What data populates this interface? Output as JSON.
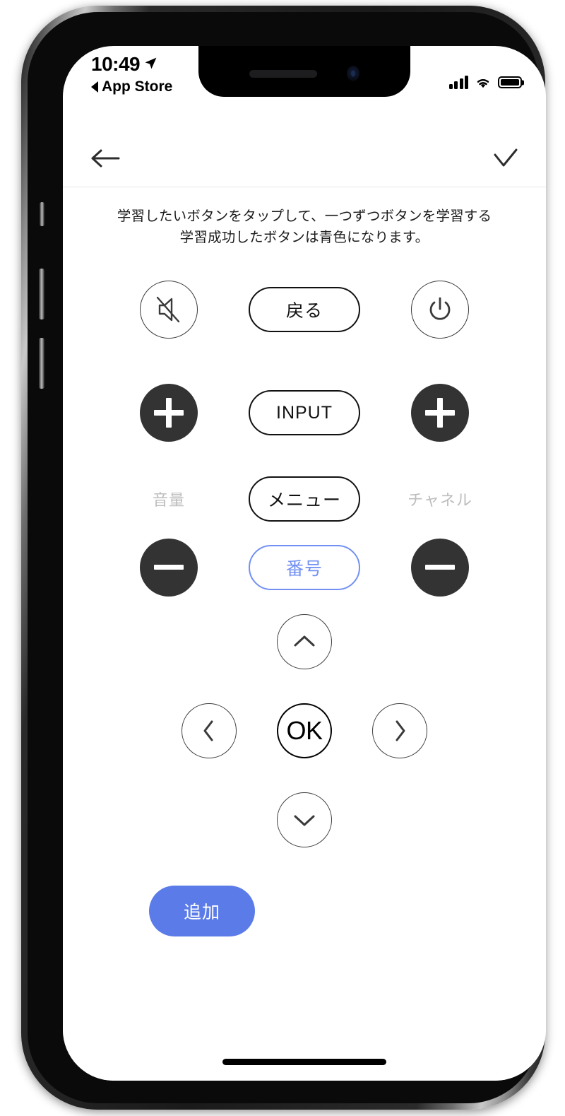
{
  "status_bar": {
    "time": "10:49",
    "location_icon": "location-arrow-icon",
    "back_app_label": "App Store",
    "signal_icon": "cellular-signal-icon",
    "wifi_icon": "wifi-icon",
    "battery_icon": "battery-full-icon"
  },
  "nav_bar": {
    "back_icon": "arrow-left-icon",
    "confirm_icon": "checkmark-icon"
  },
  "instructions": {
    "line1": "学習したいボタンをタップして、一つずつボタンを学習する",
    "line2": "学習成功したボタンは青色になります。"
  },
  "remote": {
    "row1": {
      "mute": {
        "icon": "speaker-mute-icon",
        "label": ""
      },
      "back": {
        "label": "戻る"
      },
      "power": {
        "icon": "power-icon",
        "label": ""
      }
    },
    "row2": {
      "volume_up": {
        "icon": "plus-icon"
      },
      "input": {
        "label": "INPUT"
      },
      "channel_up": {
        "icon": "plus-icon"
      }
    },
    "row3": {
      "volume_label": "音量",
      "menu": {
        "label": "メニュー"
      },
      "channel_label": "チャネル"
    },
    "row4": {
      "volume_down": {
        "icon": "minus-icon"
      },
      "number": {
        "label": "番号",
        "state": "learned"
      },
      "channel_down": {
        "icon": "minus-icon"
      }
    }
  },
  "dpad": {
    "up": "chevron-up-icon",
    "left": "chevron-left-icon",
    "ok": "OK",
    "right": "chevron-right-icon",
    "down": "chevron-down-icon"
  },
  "footer": {
    "add_label": "追加"
  },
  "colors": {
    "learned_blue": "#7290f3",
    "add_button_blue": "#5b7ce8",
    "dark_circle": "#333333",
    "muted_label_gray": "#bdbdbd"
  }
}
